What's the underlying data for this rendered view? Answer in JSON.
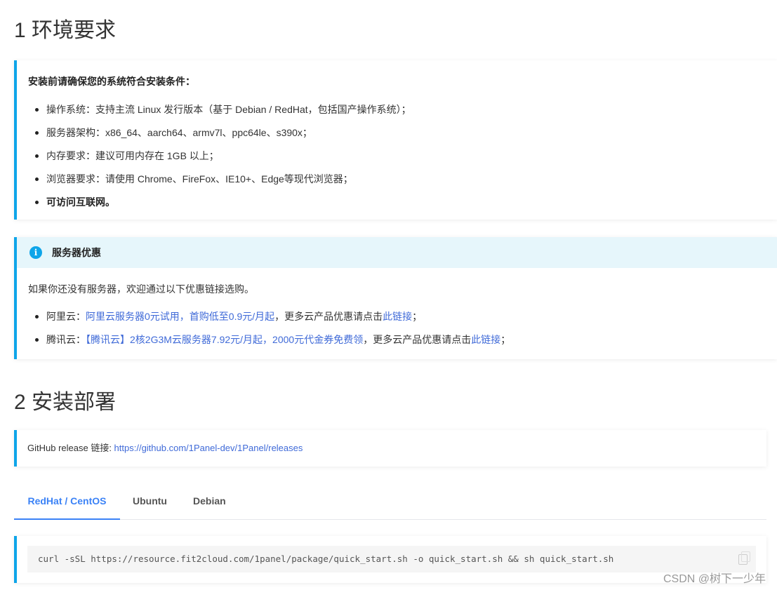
{
  "section1": {
    "heading": "1 环境要求"
  },
  "requirements": {
    "title": "安装前请确保您的系统符合安装条件：",
    "items": [
      "操作系统：支持主流 Linux 发行版本（基于 Debian / RedHat，包括国产操作系统）；",
      "服务器架构：x86_64、aarch64、armv7l、ppc64le、s390x；",
      "内存要求：建议可用内存在 1GB 以上；",
      "浏览器要求：请使用 Chrome、FireFox、IE10+、Edge等现代浏览器；",
      "可访问互联网。"
    ]
  },
  "promo": {
    "title": "服务器优惠",
    "icon": "info-icon",
    "intro": "如果你还没有服务器，欢迎通过以下优惠链接选购。",
    "aliyun": {
      "prefix": "阿里云：",
      "link": "阿里云服务器0元试用，首购低至0.9元/月起",
      "middle": "，更多云产品优惠请点击",
      "more_link": "此链接",
      "suffix": "；"
    },
    "tencent": {
      "prefix": "腾讯云：",
      "link": "【腾讯云】2核2G3M云服务器7.92元/月起，2000元代金券免费领",
      "middle": "，更多云产品优惠请点击",
      "more_link": "此链接",
      "suffix": "；"
    }
  },
  "section2": {
    "heading": "2 安装部署"
  },
  "github": {
    "label": "GitHub release 链接: ",
    "url": "https://github.com/1Panel-dev/1Panel/releases"
  },
  "tabs": [
    "RedHat / CentOS",
    "Ubuntu",
    "Debian"
  ],
  "code": {
    "command": "curl -sSL https://resource.fit2cloud.com/1panel/package/quick_start.sh -o quick_start.sh && sh quick_start.sh"
  },
  "watermark": "CSDN @树下一少年",
  "colors": {
    "accent": "#0ea5e9",
    "link": "#3f6ad8",
    "active_tab": "#3b82f6"
  }
}
